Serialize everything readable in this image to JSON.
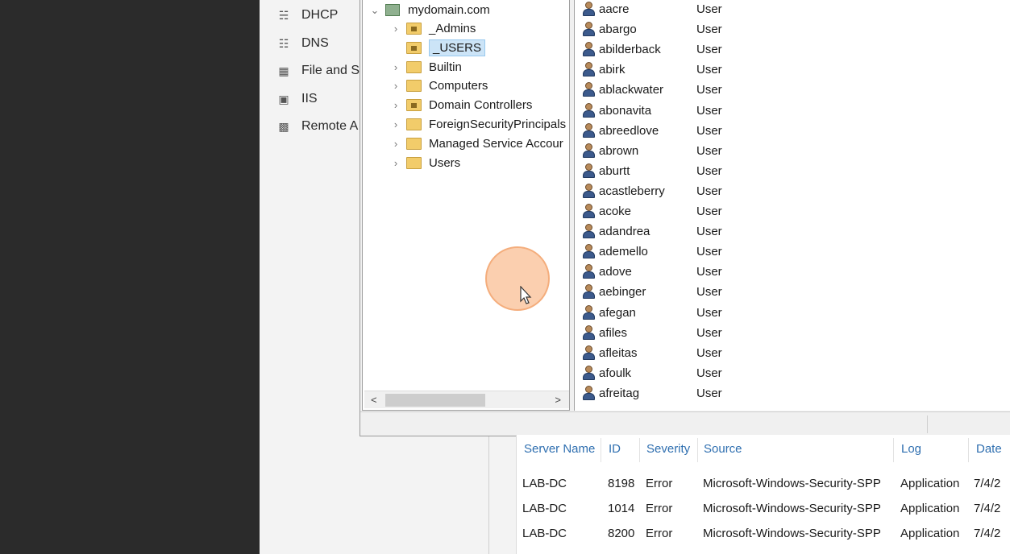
{
  "server_manager": {
    "nav_items": [
      {
        "label": "DHCP",
        "icon": "dhcp-icon"
      },
      {
        "label": "DNS",
        "icon": "dns-icon"
      },
      {
        "label": "File and S",
        "icon": "file-storage-icon"
      },
      {
        "label": "IIS",
        "icon": "iis-icon"
      },
      {
        "label": "Remote A",
        "icon": "remote-access-icon"
      }
    ]
  },
  "aduc": {
    "tree": {
      "root": "mydomain.com",
      "children": [
        {
          "label": "_Admins",
          "type": "ou",
          "expandable": true
        },
        {
          "label": "_USERS",
          "type": "ou",
          "expandable": false,
          "selected": true
        },
        {
          "label": "Builtin",
          "type": "container",
          "expandable": true
        },
        {
          "label": "Computers",
          "type": "container",
          "expandable": true
        },
        {
          "label": "Domain Controllers",
          "type": "ou",
          "expandable": true
        },
        {
          "label": "ForeignSecurityPrincipals",
          "type": "container",
          "expandable": true
        },
        {
          "label": "Managed Service Accour",
          "type": "container",
          "expandable": true
        },
        {
          "label": "Users",
          "type": "container",
          "expandable": true
        }
      ]
    },
    "users": [
      {
        "name": "aacre",
        "type": "User"
      },
      {
        "name": "abargo",
        "type": "User"
      },
      {
        "name": "abilderback",
        "type": "User"
      },
      {
        "name": "abirk",
        "type": "User"
      },
      {
        "name": "ablackwater",
        "type": "User"
      },
      {
        "name": "abonavita",
        "type": "User"
      },
      {
        "name": "abreedlove",
        "type": "User"
      },
      {
        "name": "abrown",
        "type": "User"
      },
      {
        "name": "aburtt",
        "type": "User"
      },
      {
        "name": "acastleberry",
        "type": "User"
      },
      {
        "name": "acoke",
        "type": "User"
      },
      {
        "name": "adandrea",
        "type": "User"
      },
      {
        "name": "ademello",
        "type": "User"
      },
      {
        "name": "adove",
        "type": "User"
      },
      {
        "name": "aebinger",
        "type": "User"
      },
      {
        "name": "afegan",
        "type": "User"
      },
      {
        "name": "afiles",
        "type": "User"
      },
      {
        "name": "afleitas",
        "type": "User"
      },
      {
        "name": "afoulk",
        "type": "User"
      },
      {
        "name": "afreitag",
        "type": "User"
      }
    ]
  },
  "events": {
    "headers": [
      "Server Name",
      "ID",
      "Severity",
      "Source",
      "Log",
      "Date"
    ],
    "rows": [
      {
        "server": "LAB-DC",
        "id": "8198",
        "severity": "Error",
        "source": "Microsoft-Windows-Security-SPP",
        "log": "Application",
        "date": "7/4/2"
      },
      {
        "server": "LAB-DC",
        "id": "1014",
        "severity": "Error",
        "source": "Microsoft-Windows-Security-SPP",
        "log": "Application",
        "date": "7/4/2"
      },
      {
        "server": "LAB-DC",
        "id": "8200",
        "severity": "Error",
        "source": "Microsoft-Windows-Security-SPP",
        "log": "Application",
        "date": "7/4/2"
      }
    ]
  },
  "colors": {
    "header_link": "#2f6fb0",
    "selection": "#cce4f7",
    "click_indicator": "#f7a86e"
  }
}
